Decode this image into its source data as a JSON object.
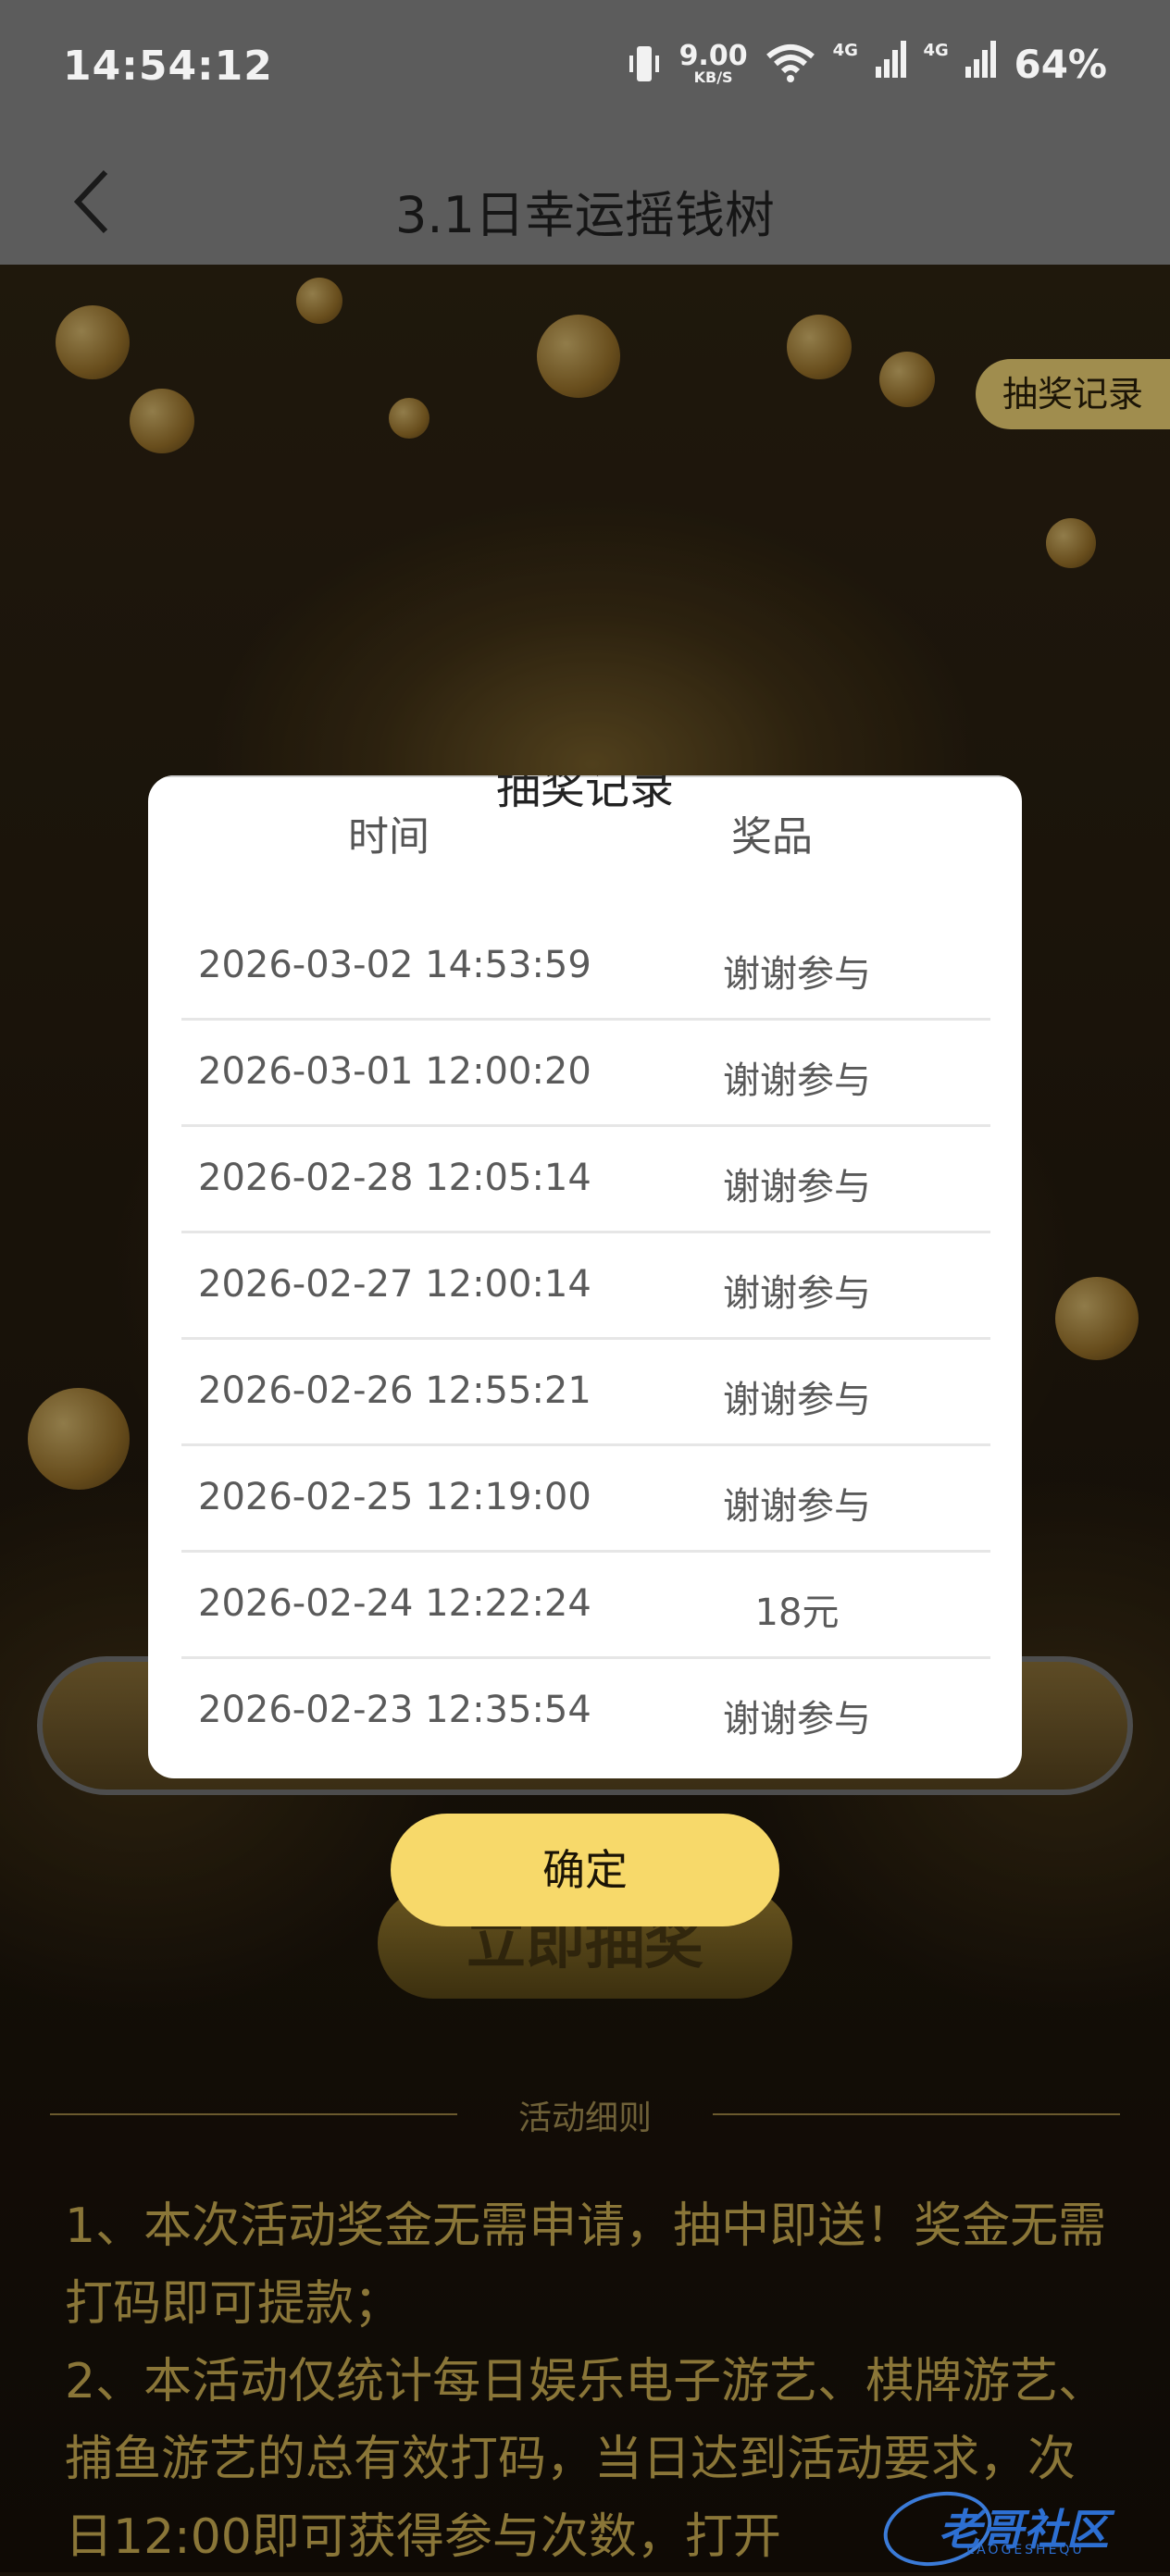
{
  "status_bar": {
    "time": "14:54:12",
    "net_speed": "9.00",
    "net_speed_unit": "KB/S",
    "network_1": "4G",
    "network_2": "4G",
    "battery": "64%"
  },
  "header": {
    "title": "3.1日幸运摇钱树"
  },
  "records_button": "抽奖记录",
  "draw_button": "立即抽奖",
  "modal": {
    "title": "抽奖记录",
    "col_time": "时间",
    "col_prize": "奖品",
    "rows": [
      {
        "time": "2026-03-02 14:53:59",
        "prize": "谢谢参与"
      },
      {
        "time": "2026-03-01 12:00:20",
        "prize": "谢谢参与"
      },
      {
        "time": "2026-02-28 12:05:14",
        "prize": "谢谢参与"
      },
      {
        "time": "2026-02-27 12:00:14",
        "prize": "谢谢参与"
      },
      {
        "time": "2026-02-26 12:55:21",
        "prize": "谢谢参与"
      },
      {
        "time": "2026-02-25 12:19:00",
        "prize": "谢谢参与"
      },
      {
        "time": "2026-02-24 12:22:24",
        "prize": "18元"
      },
      {
        "time": "2026-02-23 12:35:54",
        "prize": "谢谢参与"
      }
    ],
    "confirm": "确定"
  },
  "rules": {
    "header": "活动细则",
    "line1": "1、本次活动奖金无需申请，抽中即送！奖金无需打码即可提款；",
    "line2": "2、本活动仅统计每日娱乐电子游艺、棋牌游艺、捕鱼游艺的总有效打码，当日达到活动要求，次日12:00即可获得参与次数，打开"
  },
  "watermark": {
    "text": "老哥社区",
    "sub": "LAOGESHEQU"
  },
  "colors": {
    "confirm": "#f7d96a",
    "rules_text": "#8a7638",
    "status_bar": "#5c5c5c"
  }
}
